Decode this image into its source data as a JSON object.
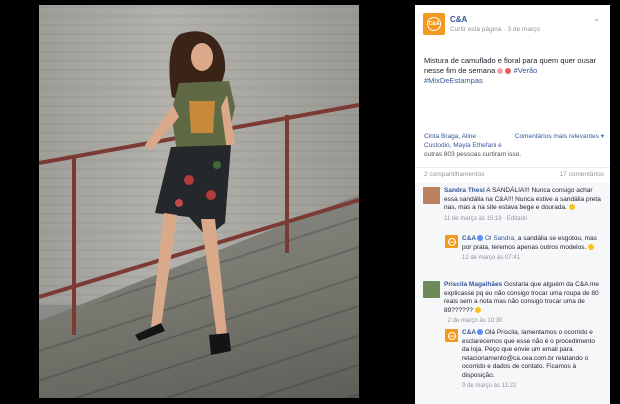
{
  "post": {
    "page_name": "C&A",
    "meta_action": "Curtir esta página",
    "date": "3 de março",
    "text_line1": "Mistura de camuflado e floral para quem quer ousar",
    "text_line2": "nesse fim de semana",
    "hashtag1": "#Verão",
    "hashtag2": "#MixDeEstampas"
  },
  "reactions": {
    "names_line1": "Cinta Braga, Aline",
    "names_line2": "Custodio, Mayla Ethefani e",
    "names_line3": "outras 803 pessoas curtiram isso.",
    "more_link": "Comentários mais relevantes ▾",
    "shares": "2 compartilhamentos",
    "comments_count": "17 comentários"
  },
  "comments": [
    {
      "author": "Sandra Thesi",
      "text": "A SANDÁLIA!!! Nunca consigo achar essa sandália na C&A!!! Nunca estive a sandália preta nas, mas a na site estava bege e dourada.",
      "meta": "11 de março às 15:19 · Editado"
    },
    {
      "author": "C&A",
      "mention": "Ol Sandra,",
      "text": "a sandália se esgotou, mas por prata, teremos apenas outros modelos.",
      "meta": "12 de março às 07:41"
    },
    {
      "author": "Priscila Magalhães",
      "text": "Gostaria que alguém da C&A me explicasse pq eu não consigo trocar uma roupa de 80 reais sem a nota mas não consigo trocar uma de 89??????",
      "meta": "· 2 de março às 10:30"
    },
    {
      "author": "C&A",
      "text": "Olá Priscila, lamentamos o ocorrido e esclarecemos que esse não é o procedimento da loja. Peço que envie um email para relacionamento@ca.cea.com.br relatando o ocorrido e dados de contato. Ficamos à disposição.",
      "meta": "9 de março às 11:22"
    }
  ],
  "colors": {
    "brand": "#f39a1e",
    "link": "#365899",
    "muted": "#90949c"
  },
  "icons": {
    "menu": "chevron-down-icon"
  }
}
